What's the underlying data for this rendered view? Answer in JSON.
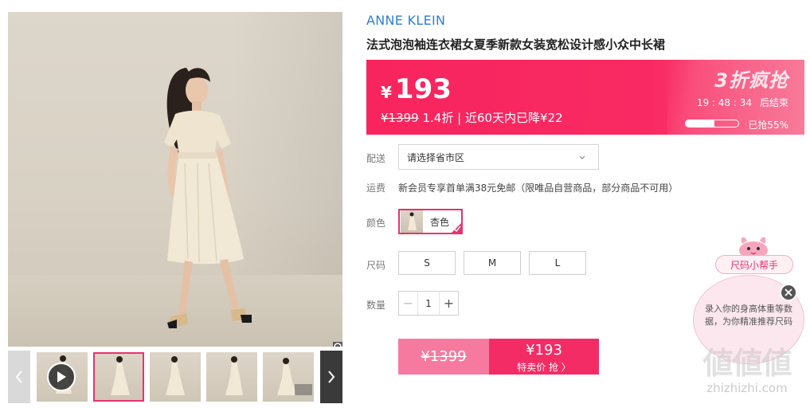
{
  "brand": "ANNE KLEIN",
  "product_title": "法式泡泡袖连衣裙女夏季新款女装宽松设计感小众中长裙",
  "price": {
    "currency": "¥",
    "current": "193",
    "original": "¥1399",
    "discount": "1.4折",
    "history_note": "| 近60天内已降¥22",
    "promo_label": "3折疯抢",
    "countdown": "19 : 48 : 34",
    "countdown_suffix": "后结束",
    "sold_percent": 55,
    "sold_label": "已抢55%"
  },
  "shipping": {
    "label": "配送",
    "placeholder": "请选择省市区"
  },
  "fee": {
    "label": "运费",
    "text": "新会员专享首单满38元免邮（限唯品自营商品，部分商品不可用）"
  },
  "color": {
    "label": "颜色",
    "selected": "杏色"
  },
  "size": {
    "label": "尺码",
    "options": [
      "S",
      "M",
      "L"
    ]
  },
  "quantity": {
    "label": "数量",
    "value": "1",
    "minus": "−",
    "plus": "+"
  },
  "buy": {
    "original_price": "¥1399",
    "special_price": "¥193",
    "special_label": "特卖价 抢 〉"
  },
  "size_helper": {
    "tag": "尺码小帮手",
    "text": "录入你的身高体重等数据，为你精准推荐尺码"
  },
  "watermark": {
    "big": "値値値",
    "small": "zhizhizhi.com"
  },
  "colors": {
    "accent": "#f32c66",
    "brand_blue": "#2e7fd6",
    "banner": "#f8245e"
  }
}
